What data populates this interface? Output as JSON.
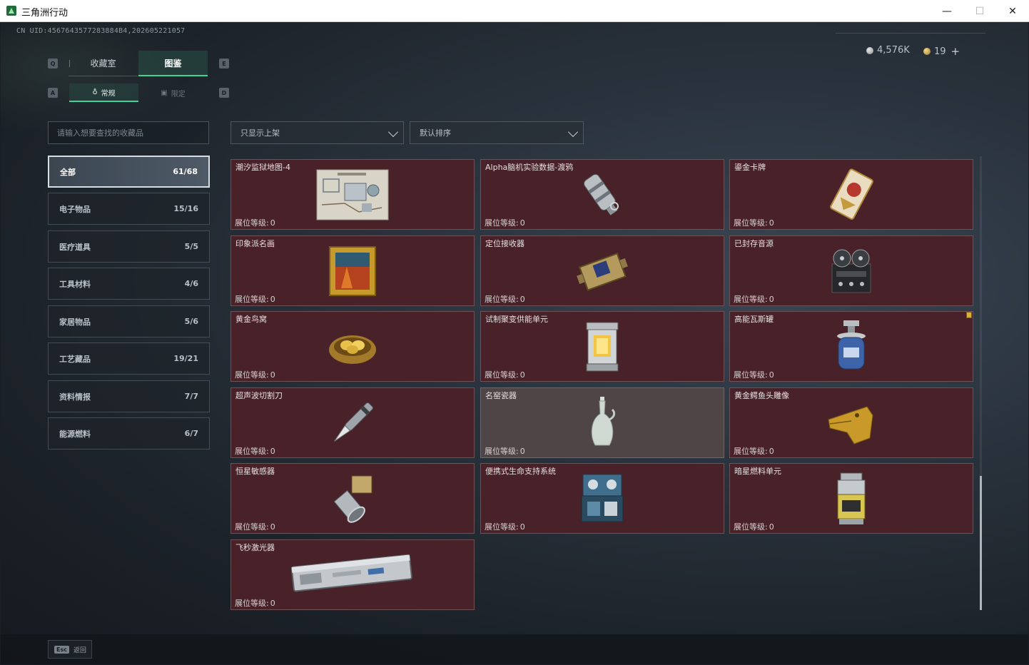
{
  "window": {
    "title": "三角洲行动",
    "min_glyph": "—",
    "max_glyph": "☐",
    "close_glyph": "✕"
  },
  "header": {
    "uid": "CN UID:4567643577283884B4,202605221057",
    "currency": [
      {
        "icon": "silver-coin-icon",
        "value": "4,576K"
      },
      {
        "icon": "gold-coin-icon",
        "value": "19"
      }
    ],
    "plus": "+"
  },
  "tabs": {
    "left_key": "Q",
    "right_key": "E",
    "items": [
      {
        "label": "收藏室"
      },
      {
        "label": "图鉴"
      }
    ],
    "active": 1
  },
  "subtabs": {
    "left_key": "A",
    "right_key": "D",
    "items": [
      {
        "label": "常规",
        "icon": "flask-icon"
      },
      {
        "label": "限定",
        "icon": "frame-icon"
      }
    ],
    "active": 0
  },
  "search": {
    "placeholder": "请输入想要查找的收藏品"
  },
  "filters": {
    "display": "只显示上架",
    "sort": "默认排序"
  },
  "categories": [
    {
      "label": "全部",
      "count": "61/68"
    },
    {
      "label": "电子物品",
      "count": "15/16"
    },
    {
      "label": "医疗道具",
      "count": "5/5"
    },
    {
      "label": "工具材料",
      "count": "4/6"
    },
    {
      "label": "家居物品",
      "count": "5/6"
    },
    {
      "label": "工艺藏品",
      "count": "19/21"
    },
    {
      "label": "资料情报",
      "count": "7/7"
    },
    {
      "label": "能源燃料",
      "count": "6/7"
    }
  ],
  "level_label": "展位等级:",
  "items": [
    {
      "name": "潮汐监狱地图-4",
      "level": "0",
      "icon": "map-icon"
    },
    {
      "name": "Alpha脑机实验数据-渡鸦",
      "level": "0",
      "icon": "data-drive-icon"
    },
    {
      "name": "鎏金卡牌",
      "level": "0",
      "icon": "card-icon"
    },
    {
      "name": "印象派名画",
      "level": "0",
      "icon": "painting-icon"
    },
    {
      "name": "定位接收器",
      "level": "0",
      "icon": "receiver-icon"
    },
    {
      "name": "已封存音源",
      "level": "0",
      "icon": "reel-recorder-icon"
    },
    {
      "name": "黄金鸟窝",
      "level": "0",
      "icon": "golden-nest-icon"
    },
    {
      "name": "试制聚变供能单元",
      "level": "0",
      "icon": "fusion-unit-icon"
    },
    {
      "name": "高能瓦斯罐",
      "level": "0",
      "icon": "gas-canister-icon"
    },
    {
      "name": "超声波切割刀",
      "level": "0",
      "icon": "cutter-icon"
    },
    {
      "name": "名窑瓷器",
      "level": "0",
      "icon": "porcelain-vase-icon"
    },
    {
      "name": "黄金鳄鱼头雕像",
      "level": "0",
      "icon": "crocodile-statue-icon"
    },
    {
      "name": "恒星敏感器",
      "level": "0",
      "icon": "star-sensor-icon"
    },
    {
      "name": "便携式生命支持系统",
      "level": "0",
      "icon": "life-support-icon"
    },
    {
      "name": "暗星燃料单元",
      "level": "0",
      "icon": "fuel-cell-icon"
    },
    {
      "name": "飞秒激光器",
      "level": "0",
      "icon": "laser-case-icon"
    }
  ],
  "footer": {
    "key": "Esc",
    "label": "返回"
  }
}
